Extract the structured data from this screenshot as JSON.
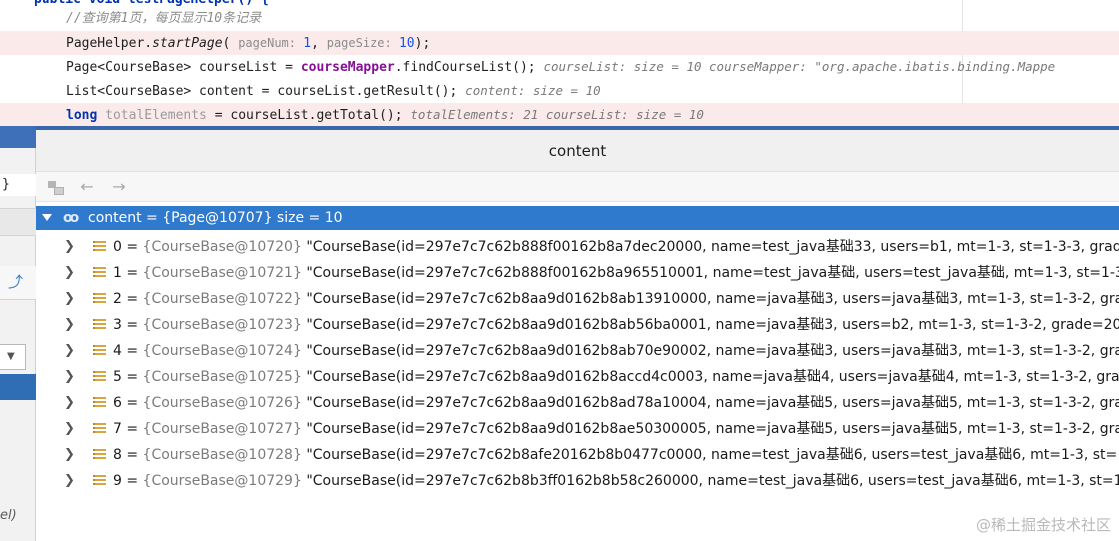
{
  "editor": {
    "lines": [
      {
        "parts": [
          {
            "c": "c-kw",
            "t": "public void testPageHelper() {"
          }
        ]
      },
      {
        "parts": [
          {
            "c": "c-comment",
            "t": "//查询第1页，每页显示10条记录"
          }
        ]
      },
      {
        "parts": [
          {
            "c": "",
            "t": "PageHelper."
          },
          {
            "c": "c-static",
            "t": "startPage"
          },
          {
            "c": "",
            "t": "( "
          },
          {
            "c": "c-hint",
            "t": "pageNum: "
          },
          {
            "c": "c-num",
            "t": "1"
          },
          {
            "c": "",
            "t": ",  "
          },
          {
            "c": "c-hint",
            "t": "pageSize: "
          },
          {
            "c": "c-num",
            "t": "10"
          },
          {
            "c": "",
            "t": ");"
          }
        ]
      },
      {
        "parts": [
          {
            "c": "",
            "t": "Page<CourseBase> courseList = "
          },
          {
            "c": "c-field",
            "t": "courseMapper"
          },
          {
            "c": "",
            "t": ".findCourseList();  "
          },
          {
            "c": "c-inline",
            "t": "courseList:  size = 10   courseMapper: \"org.apache.ibatis.binding.Mappe"
          }
        ]
      },
      {
        "parts": [
          {
            "c": "",
            "t": "List<CourseBase> content = courseList.getResult();  "
          },
          {
            "c": "c-inline",
            "t": "content:  size = 10"
          }
        ]
      },
      {
        "parts": [
          {
            "c": "c-kw",
            "t": "long "
          },
          {
            "c": "c-ghost",
            "t": "totalElements"
          },
          {
            "c": "",
            "t": " = courseList.getTotal();  "
          },
          {
            "c": "c-inline",
            "t": "totalElements: 21   courseList:  size = 10"
          }
        ]
      }
    ]
  },
  "left": {
    "brace": "}",
    "el_text": "el)"
  },
  "popup": {
    "title": "content",
    "toolbar": {
      "tree_icon": "tree-view-icon",
      "back_icon": "←",
      "forward_icon": "→"
    },
    "root": {
      "label": "content = {Page@10707}  size = 10"
    },
    "items": [
      {
        "index": "0 = ",
        "ref": "{CourseBase@10720}",
        "value": " \"CourseBase(id=297e7c7c62b888f00162b8a7dec20000, name=test_java基础33, users=b1, mt=1-3, st=1-3-3, grad"
      },
      {
        "index": "1 = ",
        "ref": "{CourseBase@10721}",
        "value": " \"CourseBase(id=297e7c7c62b888f00162b8a965510001, name=test_java基础, users=test_java基础, mt=1-3, st=1-3"
      },
      {
        "index": "2 = ",
        "ref": "{CourseBase@10722}",
        "value": " \"CourseBase(id=297e7c7c62b8aa9d0162b8ab13910000, name=java基础3, users=java基础3, mt=1-3, st=1-3-2, gra"
      },
      {
        "index": "3 = ",
        "ref": "{CourseBase@10723}",
        "value": " \"CourseBase(id=297e7c7c62b8aa9d0162b8ab56ba0001, name=java基础3, users=b2, mt=1-3, st=1-3-2, grade=20"
      },
      {
        "index": "4 = ",
        "ref": "{CourseBase@10724}",
        "value": " \"CourseBase(id=297e7c7c62b8aa9d0162b8ab70e90002, name=java基础3, users=java基础3, mt=1-3, st=1-3-2, gra"
      },
      {
        "index": "5 = ",
        "ref": "{CourseBase@10725}",
        "value": " \"CourseBase(id=297e7c7c62b8aa9d0162b8accd4c0003, name=java基础4, users=java基础4, mt=1-3, st=1-3-2, gra"
      },
      {
        "index": "6 = ",
        "ref": "{CourseBase@10726}",
        "value": " \"CourseBase(id=297e7c7c62b8aa9d0162b8ad78a10004, name=java基础5, users=java基础5, mt=1-3, st=1-3-2, gra"
      },
      {
        "index": "7 = ",
        "ref": "{CourseBase@10727}",
        "value": " \"CourseBase(id=297e7c7c62b8aa9d0162b8ae50300005, name=java基础5, users=java基础5, mt=1-3, st=1-3-2, gra"
      },
      {
        "index": "8 = ",
        "ref": "{CourseBase@10728}",
        "value": " \"CourseBase(id=297e7c7c62b8afe20162b8b0477c0000, name=test_java基础6, users=test_java基础6, mt=1-3, st="
      },
      {
        "index": "9 = ",
        "ref": "{CourseBase@10729}",
        "value": " \"CourseBase(id=297e7c7c62b8b3ff0162b8b58c260000, name=test_java基础6, users=test_java基础6, mt=1-3, st=1"
      }
    ]
  },
  "watermark": "@稀土掘金技术社区",
  "colors": {
    "selection": "#2f7acd",
    "breakpoint_line": "#fbeaea",
    "title_accent": "#3b67a8"
  }
}
